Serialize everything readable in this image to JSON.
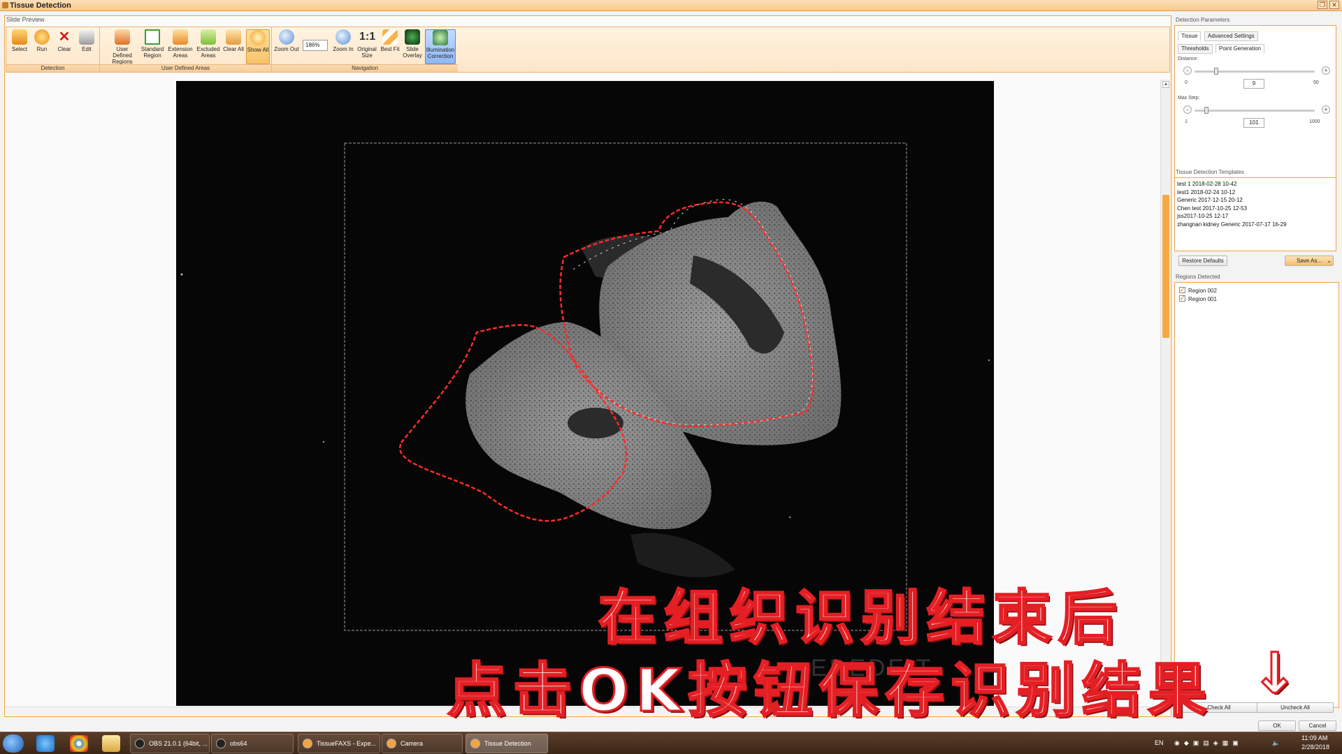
{
  "window": {
    "title": "Tissue Detection"
  },
  "slide_preview": {
    "label": "Slide Preview",
    "ribbon": {
      "groups": {
        "detection": "Detection",
        "user_defined_areas": "User Defined Areas",
        "navigation": "Navigation"
      },
      "buttons": {
        "select": "Select",
        "run": "Run",
        "clear": "Clear",
        "edit": "Edit",
        "user_defined_regions": "User Defined Regions",
        "standard_region": "Standard Region",
        "extension_areas": "Extension Areas",
        "excluded_areas": "Excluded Areas",
        "clear_all": "Clear All",
        "show_all": "Show All",
        "zoom_out": "Zoom Out",
        "zoom_in": "Zoom In",
        "original_size": "Original Size",
        "best_fit": "Best Fit",
        "slide_overlay": "Slide Overlay",
        "illumination_correction": "Illumination Correction"
      },
      "zoom_value": "186%"
    }
  },
  "detection_parameters": {
    "title": "Detection Parameters",
    "tabs": [
      "Tissue",
      "Advanced Settings"
    ],
    "subtabs": [
      "Thresholds",
      "Point Generation"
    ],
    "distance": {
      "label": "Distance:",
      "min": "0",
      "max": "50",
      "value": "9",
      "fraction": 0.18
    },
    "max_step": {
      "label": "Max Step:",
      "min": "1",
      "max": "1000",
      "value": "101",
      "fraction": 0.1
    }
  },
  "templates": {
    "title": "Tissue Detection Templates",
    "items": [
      "test 1 2018-02-28 10-42",
      "test1 2018-02-24 10-12",
      "Generic 2017-12-15 20-12",
      "Chen test 2017-10-25 12-53",
      "jss2017-10-25 12-17",
      "zhangnan kidney Generic 2017-07-17 16-29"
    ],
    "restore_defaults": "Restore Defaults",
    "save_as": "Save As..."
  },
  "regions": {
    "title": "Regions Detected",
    "items": [
      "Region 002",
      "Region 001"
    ],
    "check_all": "Check All",
    "uncheck_all": "Uncheck All"
  },
  "dialog_buttons": {
    "ok": "OK",
    "cancel": "Cancel"
  },
  "overlay": {
    "line1": "在组织识别结束后",
    "line2": "点击OK按钮保存识别结果",
    "arrow": "↓",
    "watermark": "EDEDEIT"
  },
  "taskbar": {
    "tasks": [
      "OBS 21.0.1 (64bit, ...",
      "obs64",
      "TissueFAXS - Expe...",
      "Camera",
      "Tissue Detection"
    ],
    "language": "EN",
    "time": "11:09 AM",
    "date": "2/28/2018"
  },
  "colors": {
    "accent_orange": "#f0a444",
    "outline_red": "#ff2a2a",
    "overlay_stroke": "#e41f24"
  }
}
